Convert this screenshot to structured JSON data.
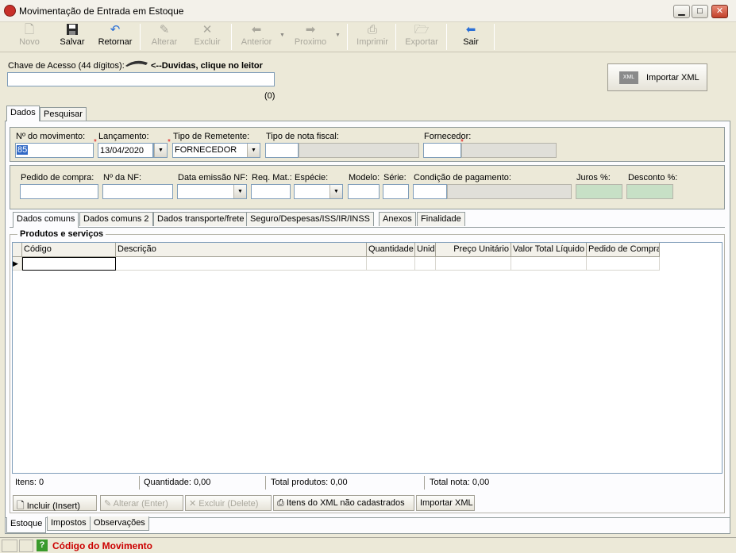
{
  "window": {
    "title": "Movimentação de Entrada em Estoque",
    "icon": "app-logo-icon",
    "min": "▁",
    "max": "□",
    "close": "✕"
  },
  "toolbar": {
    "novo": "Novo",
    "salvar": "Salvar",
    "retornar": "Retornar",
    "alterar": "Alterar",
    "excluir": "Excluir",
    "anterior": "Anterior",
    "proximo": "Proximo",
    "imprimir": "Imprimir",
    "exportar": "Exportar",
    "sair": "Sair",
    "icons": {
      "novo": "new-document-icon",
      "salvar": "floppy-disk-icon",
      "retornar": "undo-arrow-icon",
      "alterar": "edit-icon",
      "excluir": "delete-x-icon",
      "anterior": "arrow-left-icon",
      "proximo": "arrow-right-icon",
      "imprimir": "printer-icon",
      "exportar": "export-folder-icon",
      "sair": "exit-arrow-icon"
    }
  },
  "access_key": {
    "label": "Chave de Acesso (44 dígitos):",
    "help": "<--Duvidas, clique no leitor",
    "value": "",
    "count": "(0)"
  },
  "import_xml": {
    "label": "Importar XML",
    "badge": "XML"
  },
  "top_tabs": [
    "Dados",
    "Pesquisar"
  ],
  "fields": {
    "num_mov": {
      "label": "Nº do movimento:",
      "value": "85"
    },
    "lancamento": {
      "label": "Lançamento:",
      "value": "13/04/2020"
    },
    "tipo_rem": {
      "label": "Tipo de Remetente:",
      "value": "FORNECEDOR"
    },
    "tipo_nota": {
      "label": "Tipo de nota fiscal:",
      "value": ""
    },
    "fornecedor": {
      "label": "Fornecedor:",
      "value": ""
    },
    "pedido": {
      "label": "Pedido de compra:",
      "value": ""
    },
    "num_nf": {
      "label": "Nº da NF:",
      "value": ""
    },
    "data_emissao": {
      "label": "Data emissão NF:",
      "value": ""
    },
    "req_mat": {
      "label": "Req. Mat.:",
      "value": ""
    },
    "especie": {
      "label": "Espécie:",
      "value": ""
    },
    "modelo": {
      "label": "Modelo:",
      "value": ""
    },
    "serie": {
      "label": "Série:",
      "value": ""
    },
    "cond_pag": {
      "label": "Condição de pagamento:",
      "value": ""
    },
    "juros": {
      "label": "Juros %:",
      "value": ""
    },
    "desconto": {
      "label": "Desconto %:",
      "value": ""
    }
  },
  "sub_tabs": [
    "Dados comuns",
    "Dados comuns 2",
    "Dados transporte/frete",
    "Seguro/Despesas/ISS/IR/INSS",
    "Anexos",
    "Finalidade"
  ],
  "products": {
    "title": "Produtos e serviços",
    "columns": [
      "Código",
      "Descrição",
      "Quantidade",
      "Unid",
      "Preço Unitário",
      "Valor Total Líquido",
      "Pedido de Compra"
    ]
  },
  "totals": {
    "itens": "Itens: 0",
    "quantidade": "Quantidade: 0,00",
    "total_produtos": "Total produtos: 0,00",
    "total_nota": "Total nota: 0,00"
  },
  "grid_buttons": {
    "incluir": "Incluir (Insert)",
    "alterar": "Alterar (Enter)",
    "excluir": "Excluir (Delete)",
    "itens_xml": "Itens do XML não cadastrados",
    "importar": "Importar XML"
  },
  "bottom_tabs": [
    "Estoque",
    "Impostos",
    "Observações"
  ],
  "status": {
    "help_icon": "help-question-icon",
    "text": "Código do Movimento",
    "text_color": "#cc0000"
  }
}
